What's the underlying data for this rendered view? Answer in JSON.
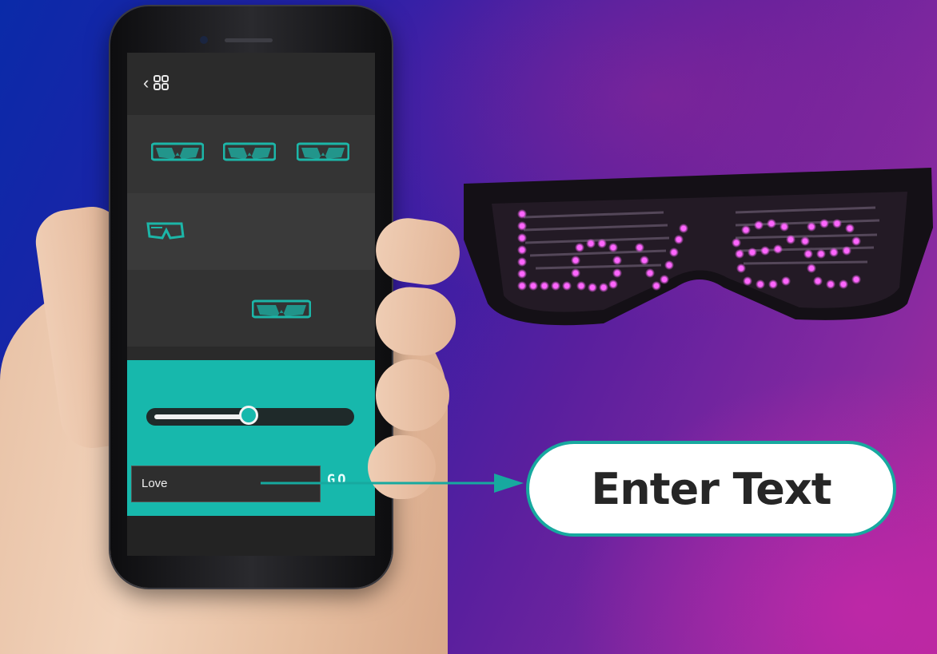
{
  "phone_app": {
    "back_glyph": "‹",
    "input_value": "Love",
    "send_label": "GO",
    "brightness_slider": {
      "value_fraction": 0.47
    }
  },
  "callout": {
    "label": "Enter Text"
  },
  "led_display": {
    "text": "Love",
    "led_color": "#ff66ff"
  },
  "colors": {
    "teal": "#17b8ac",
    "callout_border": "#17a99f",
    "icon_teal": "#1cb6a8"
  },
  "icons": [
    "back-arrow",
    "grid-menu-icon",
    "led-glasses-icon",
    "slider-knob"
  ]
}
